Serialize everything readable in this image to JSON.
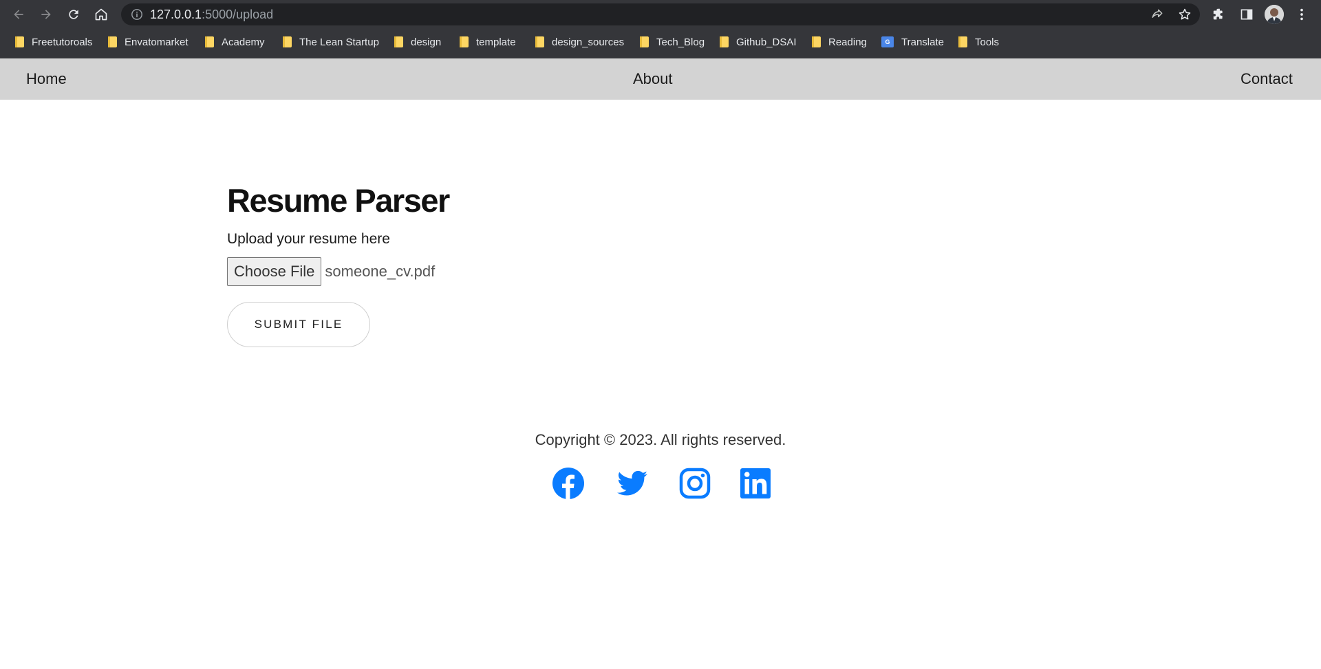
{
  "browser": {
    "url_host": "127.0.0.1",
    "url_path": ":5000/upload",
    "bookmarks": [
      {
        "label": "Freetutoroals",
        "icon": "folder-icon"
      },
      {
        "label": "Envatomarket",
        "icon": "folder-icon"
      },
      {
        "label": "Academy",
        "icon": "folder-icon"
      },
      {
        "label": "The Lean Startup",
        "icon": "folder-icon"
      },
      {
        "label": "design",
        "icon": "folder-icon"
      },
      {
        "label": "template",
        "icon": "folder-icon"
      },
      {
        "label": "design_sources",
        "icon": "folder-icon"
      },
      {
        "label": "Tech_Blog",
        "icon": "folder-icon"
      },
      {
        "label": "Github_DSAI",
        "icon": "folder-icon"
      },
      {
        "label": "Reading",
        "icon": "folder-icon"
      },
      {
        "label": "Translate",
        "icon": "google-translate-icon"
      },
      {
        "label": "Tools",
        "icon": "folder-icon"
      }
    ]
  },
  "nav": {
    "home": "Home",
    "about": "About",
    "contact": "Contact"
  },
  "main": {
    "title": "Resume Parser",
    "upload_label": "Upload your resume here",
    "choose_file_label": "Choose File",
    "file_name": "someone_cv.pdf",
    "submit_label": "SUBMIT FILE"
  },
  "footer": {
    "copyright": "Copyright © 2023. All rights reserved.",
    "social": [
      "facebook-icon",
      "twitter-icon",
      "instagram-icon",
      "linkedin-icon"
    ],
    "social_color": "#0a7cff"
  },
  "colors": {
    "chrome_bg": "#35363a",
    "omnibox_bg": "#202124",
    "nav_bg": "#d3d3d3",
    "folder": "#fdd663"
  }
}
